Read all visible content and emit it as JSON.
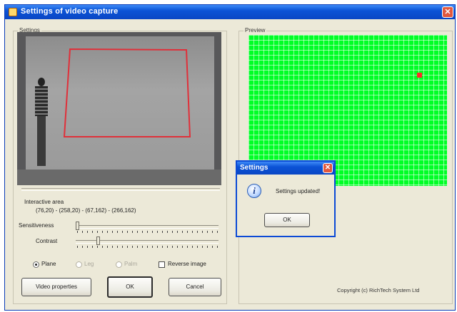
{
  "window": {
    "title": "Settings of video capture",
    "close_glyph": "✕"
  },
  "settings": {
    "group_label": "Settings",
    "interactive_area_label": "Interactive area",
    "interactive_area_value": "(76,20) - (258,20) - (67,162) - (266,162)",
    "sensitiveness_label": "Sensitiveness",
    "contrast_label": "Contrast",
    "sensitiveness_level": 0.0,
    "contrast_level": 0.15,
    "modes": [
      {
        "label": "Plane",
        "selected": true,
        "enabled": true
      },
      {
        "label": "Leg",
        "selected": false,
        "enabled": false
      },
      {
        "label": "Palm",
        "selected": false,
        "enabled": false
      }
    ],
    "reverse_image_label": "Reverse image",
    "reverse_image_checked": false
  },
  "preview": {
    "group_label": "Preview",
    "grid_color": "#00ff26",
    "active_cell_color": "#ff2a2a"
  },
  "buttons": {
    "video_properties": "Video properties",
    "ok": "OK",
    "cancel": "Cancel"
  },
  "dialog": {
    "title": "Settings",
    "close_glyph": "✕",
    "message": "Settings updated!",
    "ok": "OK",
    "icon": "info-icon"
  },
  "footer": {
    "copyright": "Copyright (c) RichTech System Ltd"
  },
  "colors": {
    "titlebar": "#0b53d6",
    "detection_area": "#e0303a"
  }
}
